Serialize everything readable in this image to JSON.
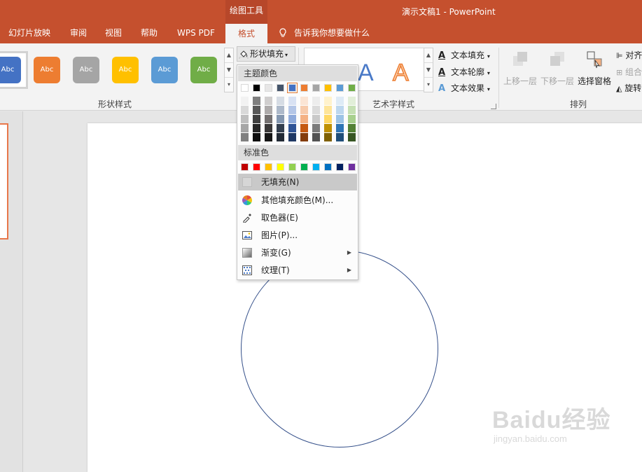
{
  "titlebar": {
    "contextual_tab": "绘图工具",
    "doc_title": "演示文稿1  -  PowerPoint"
  },
  "tabs": [
    {
      "label": "幻灯片放映"
    },
    {
      "label": "审阅"
    },
    {
      "label": "视图"
    },
    {
      "label": "帮助"
    },
    {
      "label": "WPS PDF"
    },
    {
      "label": "格式",
      "active": true
    }
  ],
  "tell_me": "告诉我你想要做什么",
  "ribbon": {
    "shape_styles": {
      "label": "形状样式",
      "swatch_text": "Abc",
      "swatches": [
        {
          "color": "#4472c4",
          "name": "blue-dark"
        },
        {
          "color": "#ed7d31",
          "name": "orange"
        },
        {
          "color": "#a5a5a5",
          "name": "gray"
        },
        {
          "color": "#ffc000",
          "name": "gold"
        },
        {
          "color": "#5b9bd5",
          "name": "blue"
        },
        {
          "color": "#70ad47",
          "name": "green"
        }
      ],
      "fill_button": "形状填充"
    },
    "wordart": {
      "label": "艺术字样式",
      "letter": "A",
      "text_fill": "文本填充",
      "text_outline": "文本轮廓",
      "text_effect": "文本效果"
    },
    "arrange": {
      "label": "排列",
      "bring_forward": "上移一层",
      "send_backward": "下移一层",
      "selection_pane": "选择窗格",
      "align": "对齐",
      "group": "组合",
      "rotate": "旋转"
    }
  },
  "dropdown": {
    "theme_colors_label": "主题颜色",
    "standard_colors_label": "标准色",
    "theme_top": [
      "#ffffff",
      "#000000",
      "#e7e6e6",
      "#44546a",
      "#4472c4",
      "#ed7d31",
      "#a5a5a5",
      "#ffc000",
      "#5b9bd5",
      "#70ad47"
    ],
    "theme_shades": [
      [
        "#f2f2f2",
        "#d9d9d9",
        "#bfbfbf",
        "#a6a6a6",
        "#808080"
      ],
      [
        "#7f7f7f",
        "#595959",
        "#404040",
        "#262626",
        "#0d0d0d"
      ],
      [
        "#d0cece",
        "#aeabab",
        "#757171",
        "#3a3838",
        "#161616"
      ],
      [
        "#d6dce4",
        "#adb9ca",
        "#8497b0",
        "#333f4f",
        "#222a35"
      ],
      [
        "#d9e2f3",
        "#b4c6e7",
        "#8eaadb",
        "#2f5496",
        "#1f3864"
      ],
      [
        "#fbe5d5",
        "#f7cbac",
        "#f4b183",
        "#c55a11",
        "#833c0b"
      ],
      [
        "#ededed",
        "#dbdbdb",
        "#c9c9c9",
        "#7b7b7b",
        "#525252"
      ],
      [
        "#fff2cc",
        "#fee599",
        "#ffd965",
        "#bf9000",
        "#7f6000"
      ],
      [
        "#deebf6",
        "#bdd7ee",
        "#9cc3e5",
        "#2e75b5",
        "#1f4e79"
      ],
      [
        "#e2efd9",
        "#c5e0b3",
        "#a8d08d",
        "#538135",
        "#375623"
      ]
    ],
    "standard": [
      "#c00000",
      "#ff0000",
      "#ffc000",
      "#ffff00",
      "#92d050",
      "#00b050",
      "#00b0f0",
      "#0070c0",
      "#002060",
      "#7030a0"
    ],
    "items": [
      {
        "label": "无填充(N)",
        "icon": "no-fill-icon"
      },
      {
        "label": "其他填充颜色(M)...",
        "icon": "color-wheel-icon"
      },
      {
        "label": "取色器(E)",
        "icon": "eyedropper-icon"
      },
      {
        "label": "图片(P)...",
        "icon": "picture-icon"
      },
      {
        "label": "渐变(G)",
        "icon": "gradient-icon",
        "submenu": true
      },
      {
        "label": "纹理(T)",
        "icon": "texture-icon",
        "submenu": true
      }
    ]
  },
  "watermark": {
    "main": "Baidu经验",
    "sub": "jingyan.baidu.com"
  }
}
